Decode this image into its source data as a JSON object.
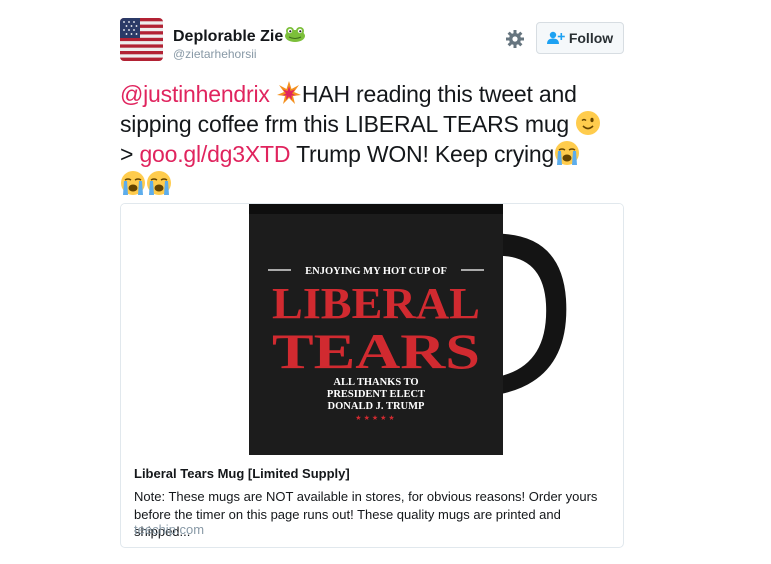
{
  "user": {
    "display_name": "Deplorable Zie",
    "handle": "@zietarhehorsii",
    "avatar_icon": "us-flag-avatar",
    "name_emoji": "frog-emoji"
  },
  "actions": {
    "settings_icon": "gear-icon",
    "follow_label": "Follow",
    "follow_icon": "add-user-icon"
  },
  "tweet": {
    "mention": "@justinhendrix",
    "text_part_1": "HAH reading this tweet and sipping coffee frm this LIBERAL TEARS mug",
    "text_part_2": ">",
    "link_text": "goo.gl/dg3XTD",
    "text_part_3": "Trump WON! Keep crying",
    "emojis": [
      "collision-emoji",
      "winking-face-emoji",
      "loudly-crying-face-emoji",
      "loudly-crying-face-emoji",
      "loudly-crying-face-emoji"
    ]
  },
  "card": {
    "mug": {
      "top_line": "ENJOYING MY HOT CUP OF",
      "big_line_1": "LIBERAL",
      "big_line_2": "TEARS",
      "bottom_line_1": "ALL THANKS TO",
      "bottom_line_2": "PRESIDENT ELECT",
      "bottom_line_3": "DONALD J. TRUMP",
      "stars": "★★★★★"
    },
    "title": "Liberal Tears Mug [Limited Supply]",
    "description": "Note: These mugs are NOT available in stores, for obvious reasons! Order yours before the timer on this page runs out! These quality mugs are printed and shipped...",
    "domain": "teechip.com"
  },
  "colors": {
    "link": "#e0245e",
    "mug_body": "#1c1c1c",
    "mug_red": "#d12a30"
  }
}
